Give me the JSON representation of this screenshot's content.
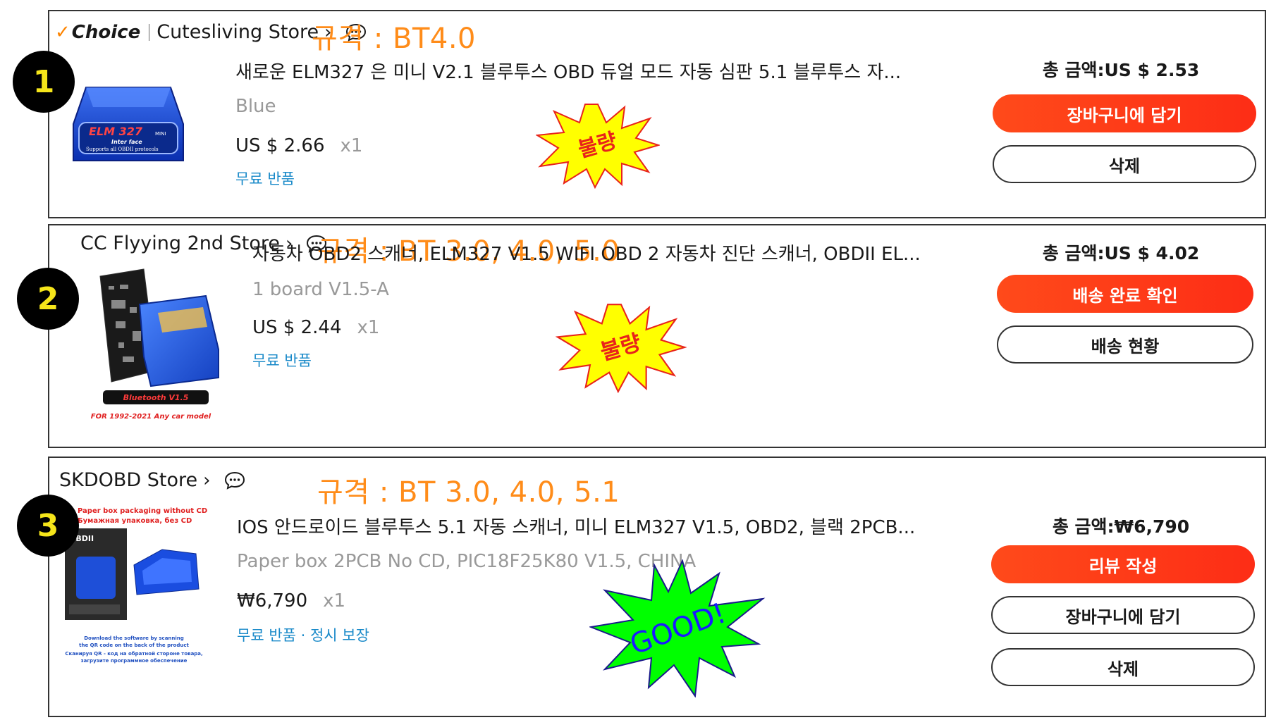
{
  "orders": [
    {
      "badge_number": "1",
      "store": {
        "choice_label": "Choice",
        "name": "Cutesliving Store"
      },
      "spec_note": "규격 : BT4.0",
      "product_title": "새로운 ELM327 은 미니 V2.1 블루투스 OBD 듀얼 모드 자동 심판 5.1 블루투스 자...",
      "variant": "Blue",
      "price": "US $ 2.66",
      "qty": "x1",
      "perks": "무료 반품",
      "total": "총 금액:US $ 2.53",
      "buttons": {
        "primary": "장바구니에 담기",
        "secondary": "삭제"
      },
      "stamp": "불량",
      "product_image_text": {
        "brand": "ELM 327",
        "mini": "MINI",
        "line1": "Inter face",
        "line2": "Supports all OBDII protocols"
      }
    },
    {
      "badge_number": "2",
      "store": {
        "name": "CC Flyying 2nd Store"
      },
      "spec_note": "규격 : BT 3.0, 4.0, 5.0",
      "product_title": "자동차 OBD2 스캐너, ELM327 V1.5 WIFI OBD 2 자동차 진단 스캐너, OBDII EL...",
      "variant": "1 board V1.5-A",
      "price": "US $ 2.44",
      "qty": "x1",
      "perks": "무료 반품",
      "total": "총 금액:US $ 4.02",
      "buttons": {
        "primary": "배송 완료 확인",
        "secondary": "배송 현황"
      },
      "stamp": "불량",
      "product_image_text": {
        "label": "Bluetooth V1.5",
        "caption": "FOR 1992-2021 Any car model"
      }
    },
    {
      "badge_number": "3",
      "store": {
        "name": "SKDOBD Store"
      },
      "spec_note": "규격 : BT 3.0, 4.0, 5.1",
      "product_title": "IOS 안드로이드 블루투스 5.1 자동 스캐너, 미니 ELM327 V1.5, OBD2, 블랙 2PCB...",
      "variant": "Paper box 2PCB No CD, PIC18F25K80 V1.5, CHINA",
      "price": "₩6,790",
      "qty": "x1",
      "perks": "무료 반품 · 정시 보장",
      "total": "총 금액:₩6,790",
      "buttons": {
        "primary": "리뷰 작성",
        "secondary": "장바구니에 담기",
        "tertiary": "삭제"
      },
      "stamp": "GOOD!",
      "product_image_text": {
        "line1": "Paper box packaging without CD",
        "line2": "Бумажная упаковка, без CD",
        "box_label": "OBDII",
        "footer1": "Download the software by scanning",
        "footer2": "the QR code on the back of the product",
        "footer3": "Сканируя QR - код на обратной стороне товара,",
        "footer4": "загрузите программное обеспечение"
      }
    }
  ],
  "colors": {
    "accent_orange": "#ff8c19",
    "button_red": "#fe4115",
    "link_blue": "#1a8ac9",
    "stamp_bad_fill": "#ffff00",
    "stamp_bad_text": "#e8231b",
    "stamp_good_fill": "#00ff00",
    "stamp_good_text": "#1a1aff"
  },
  "icons": [
    "check-icon",
    "chevron-right-icon",
    "chat-bubble-icon"
  ]
}
